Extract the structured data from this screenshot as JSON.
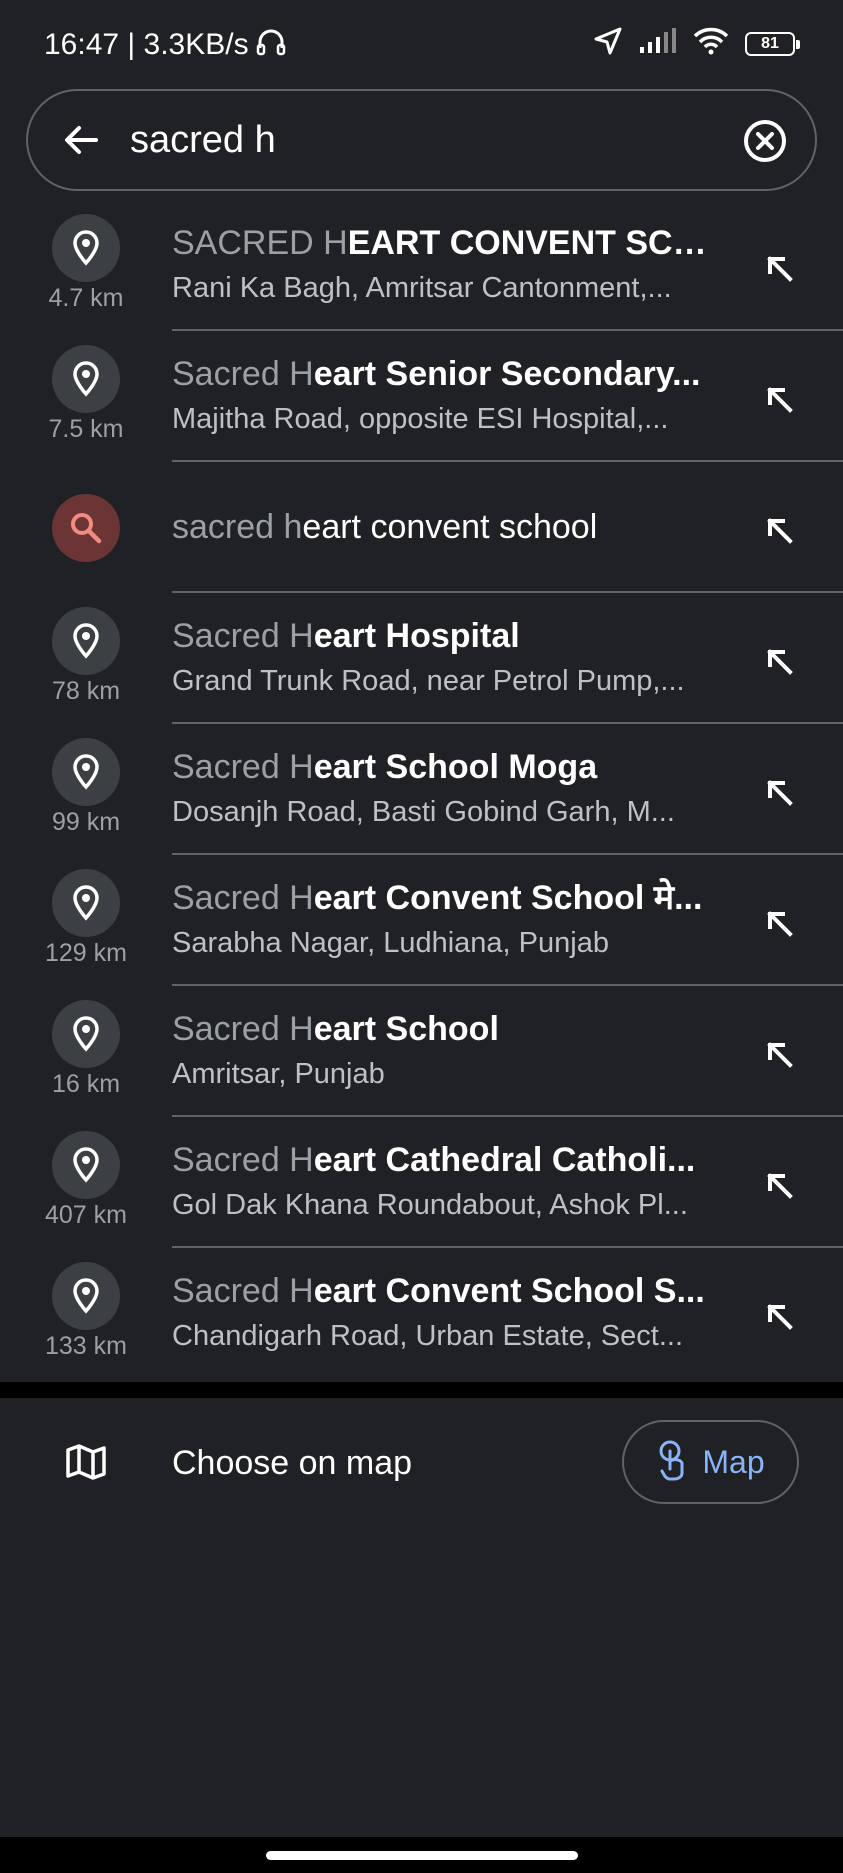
{
  "status_bar": {
    "time_speed": "16:47 | 3.3KB/s",
    "battery": "81"
  },
  "search": {
    "query": "sacred h"
  },
  "results": [
    {
      "type": "place",
      "match": "SACRED H",
      "rest": "EART CONVENT SCH...",
      "subtitle": "Rani Ka Bagh, Amritsar Cantonment,...",
      "distance": "4.7 km"
    },
    {
      "type": "place",
      "match": "Sacred H",
      "rest": "eart Senior Secondary...",
      "subtitle": "Majitha Road, opposite ESI Hospital,...",
      "distance": "7.5 km"
    },
    {
      "type": "query",
      "match": "sacred h",
      "rest": "eart convent school"
    },
    {
      "type": "place",
      "match": "Sacred H",
      "rest": "eart Hospital",
      "subtitle": "Grand Trunk Road, near Petrol Pump,...",
      "distance": "78 km"
    },
    {
      "type": "place",
      "match": "Sacred H",
      "rest": "eart School Moga",
      "subtitle": "Dosanjh Road, Basti Gobind Garh, M...",
      "distance": "99 km"
    },
    {
      "type": "place",
      "match": "Sacred H",
      "rest": "eart Convent School मे...",
      "subtitle": "Sarabha Nagar, Ludhiana, Punjab",
      "distance": "129 km"
    },
    {
      "type": "place",
      "match": "Sacred H",
      "rest": "eart School",
      "subtitle": "Amritsar, Punjab",
      "distance": "16 km"
    },
    {
      "type": "place",
      "match": "Sacred H",
      "rest": "eart Cathedral Catholi...",
      "subtitle": "Gol Dak Khana Roundabout, Ashok Pl...",
      "distance": "407 km"
    },
    {
      "type": "place",
      "match": "Sacred H",
      "rest": "eart Convent School S...",
      "subtitle": "Chandigarh Road, Urban Estate, Sect...",
      "distance": "133 km"
    }
  ],
  "choose_on_map": {
    "label": "Choose on map",
    "button_label": "Map"
  },
  "colors": {
    "background": "#202124",
    "accent": "#8ab4f8",
    "query_icon_bg": "#6b3535",
    "query_icon": "#f28b82"
  },
  "icons": {
    "place": "location-pin-icon",
    "query": "search-icon",
    "fill": "arrow-up-left-icon",
    "map": "map-icon",
    "pin_drop": "touch-pin-icon"
  }
}
